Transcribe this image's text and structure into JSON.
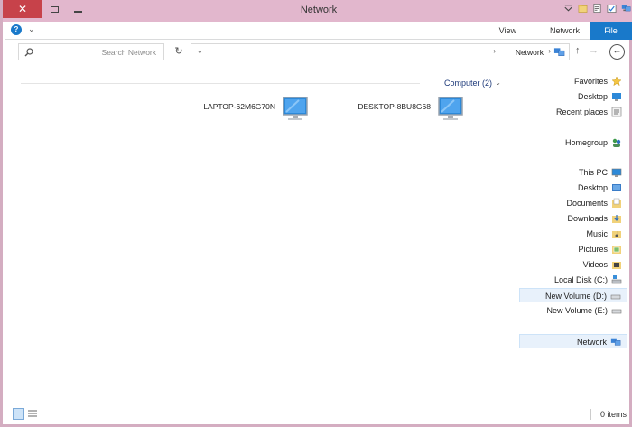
{
  "window": {
    "title": "Network",
    "close_glyph": "✕"
  },
  "ribbon": {
    "tabs": [
      {
        "label": "File",
        "active": true
      },
      {
        "label": "Network"
      },
      {
        "label": "View"
      }
    ],
    "help_glyph": "?"
  },
  "address": {
    "path": "Network",
    "search_placeholder": "Search Network",
    "breadcrumb_sep": "›",
    "drop_glyph": "⌄"
  },
  "content": {
    "group_label": "Computer (2)",
    "computers": [
      {
        "name": "DESKTOP-8BU8G68"
      },
      {
        "name": "LAPTOP-62M6G70N"
      }
    ]
  },
  "navpane": {
    "items": [
      {
        "label": "Favorites",
        "icon": "star-icon"
      },
      {
        "label": "Desktop",
        "icon": "desktop-icon"
      },
      {
        "label": "Recent places",
        "icon": "recent-places-icon"
      },
      {
        "label": "Homegroup",
        "icon": "homegroup-icon"
      },
      {
        "label": "This PC",
        "icon": "computer-icon"
      },
      {
        "label": "Desktop",
        "icon": "desktop-folder-icon"
      },
      {
        "label": "Documents",
        "icon": "documents-icon"
      },
      {
        "label": "Downloads",
        "icon": "downloads-icon"
      },
      {
        "label": "Music",
        "icon": "music-icon"
      },
      {
        "label": "Pictures",
        "icon": "pictures-icon"
      },
      {
        "label": "Videos",
        "icon": "videos-icon"
      },
      {
        "label": "Local Disk (C:)",
        "icon": "local-disk-icon"
      },
      {
        "label": "New Volume (D:)",
        "icon": "drive-icon"
      },
      {
        "label": "New Volume (E:)",
        "icon": "drive-icon"
      },
      {
        "label": "Network",
        "icon": "network-icon"
      }
    ]
  },
  "status": {
    "items_count": "0 items"
  },
  "colors": {
    "accent": "#1979ca",
    "titlebar": "#e2b7cd",
    "close": "#c7424a"
  }
}
